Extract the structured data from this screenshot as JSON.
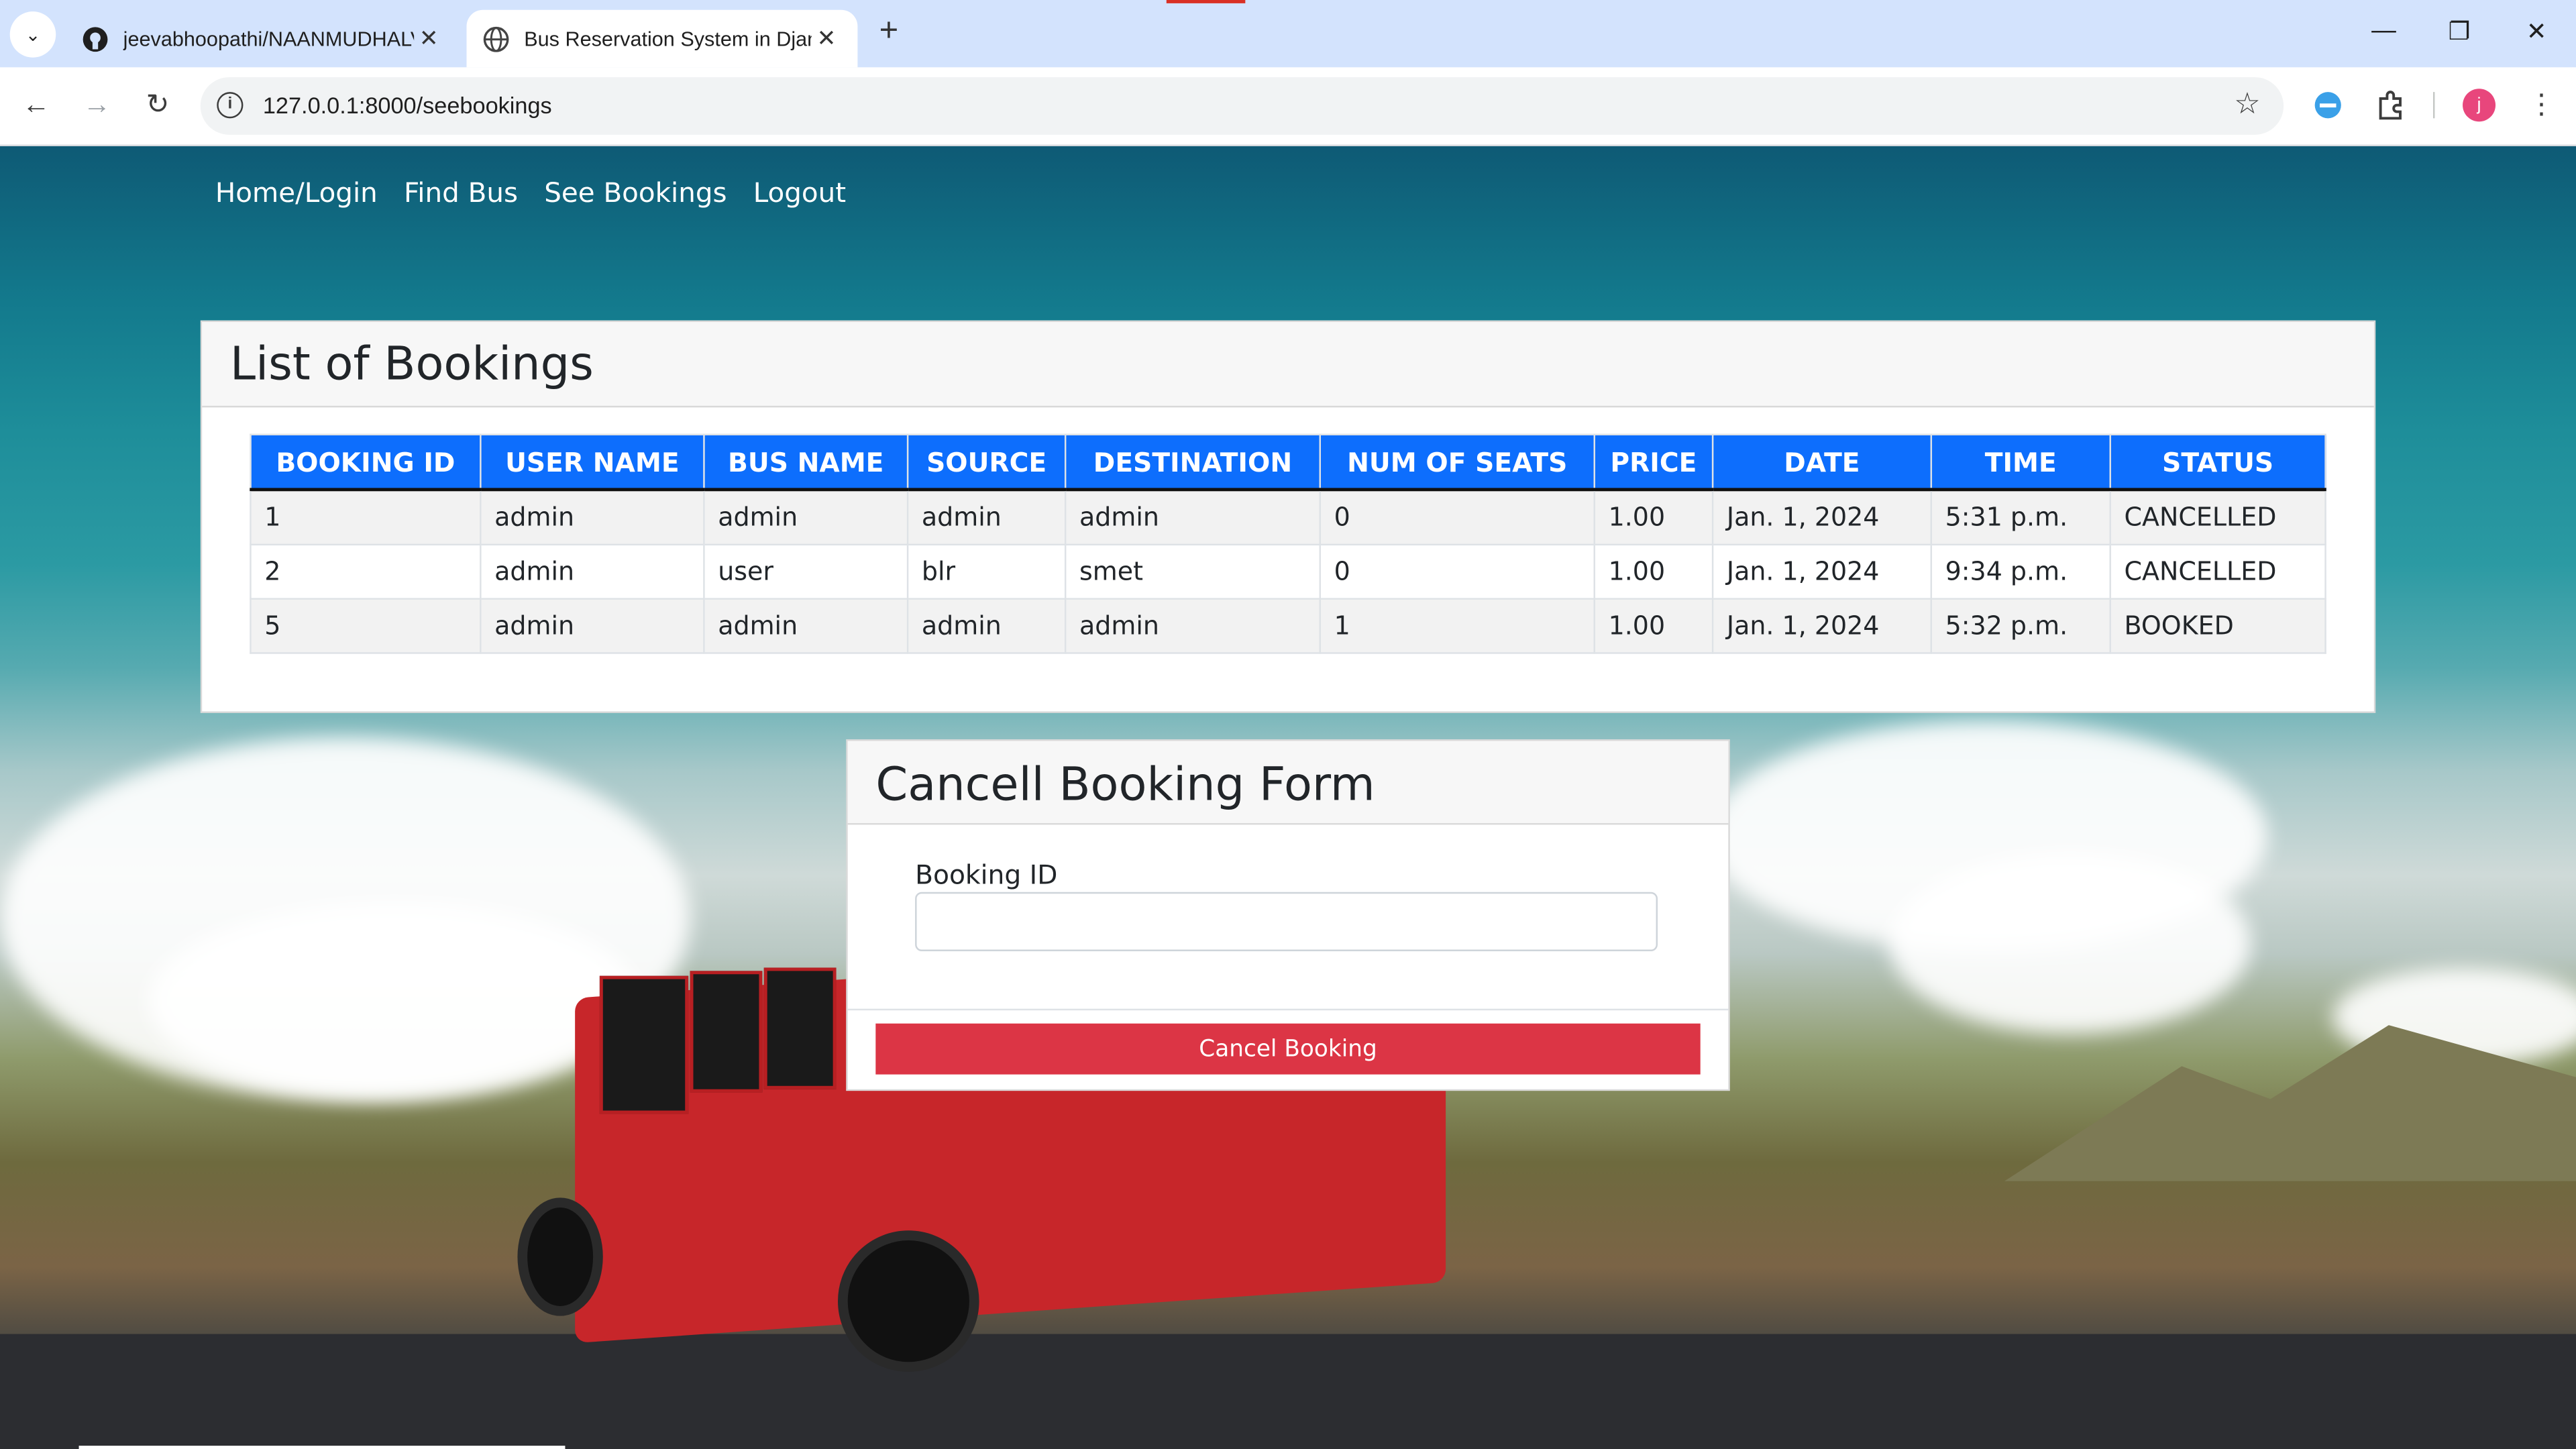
{
  "browser": {
    "tabs": [
      {
        "title": "jeevabhoopathi/NAANMUDHALVAN",
        "active": false,
        "icon": "github-icon"
      },
      {
        "title": "Bus Reservation System in Django",
        "active": true,
        "icon": "globe-icon"
      }
    ],
    "url": "127.0.0.1:8000/seebookings",
    "profile_initial": "j"
  },
  "nav": {
    "items": [
      "Home/Login",
      "Find Bus",
      "See Bookings",
      "Logout"
    ]
  },
  "bookings": {
    "title": "List of Bookings",
    "columns": [
      "BOOKING ID",
      "USER NAME",
      "BUS NAME",
      "SOURCE",
      "DESTINATION",
      "NUM OF SEATS",
      "PRICE",
      "DATE",
      "TIME",
      "STATUS"
    ],
    "rows": [
      [
        "1",
        "admin",
        "admin",
        "admin",
        "admin",
        "0",
        "1.00",
        "Jan. 1, 2024",
        "5:31 p.m.",
        "CANCELLED"
      ],
      [
        "2",
        "admin",
        "user",
        "blr",
        "smet",
        "0",
        "1.00",
        "Jan. 1, 2024",
        "9:34 p.m.",
        "CANCELLED"
      ],
      [
        "5",
        "admin",
        "admin",
        "admin",
        "admin",
        "1",
        "1.00",
        "Jan. 1, 2024",
        "5:32 p.m.",
        "BOOKED"
      ]
    ]
  },
  "cancel_form": {
    "title": "Cancell Booking Form",
    "field_label": "Booking ID",
    "field_value": "",
    "button_label": "Cancel Booking"
  },
  "colors": {
    "header_blue": "#0d6efd",
    "cancel_red": "#dc3545"
  }
}
